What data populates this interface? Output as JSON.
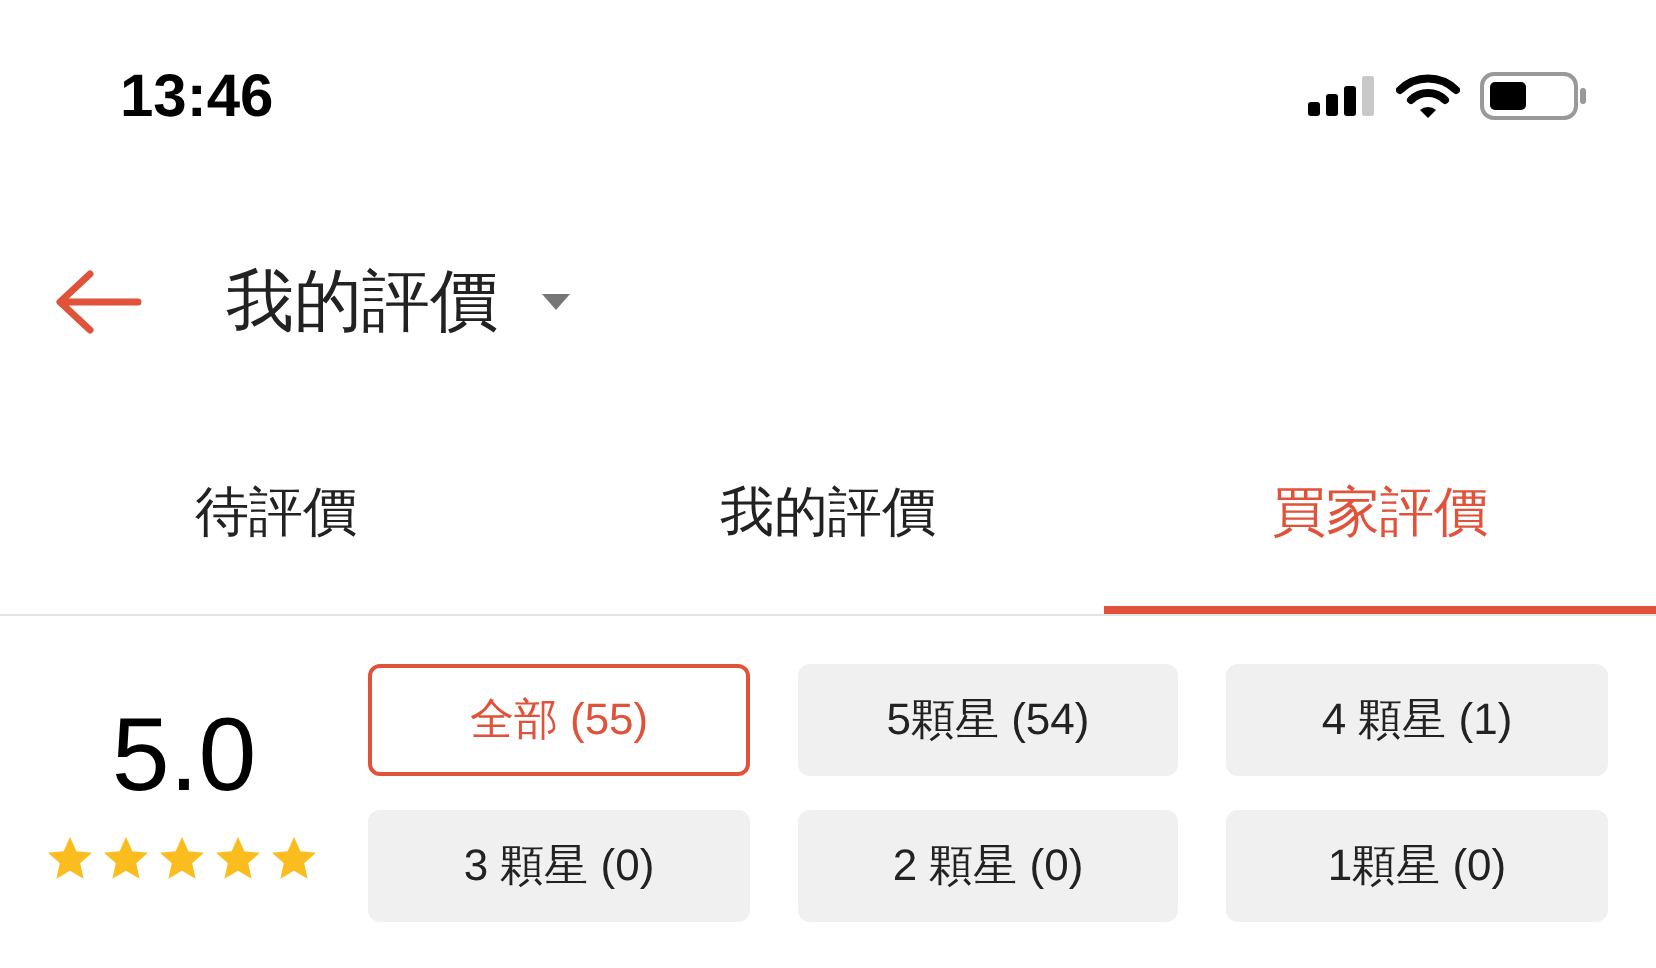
{
  "status_bar": {
    "time": "13:46"
  },
  "header": {
    "title": "我的評價"
  },
  "tabs": [
    {
      "label": "待評價",
      "selected": false
    },
    {
      "label": "我的評價",
      "selected": false
    },
    {
      "label": "買家評價",
      "selected": true
    }
  ],
  "rating": {
    "score": "5.0",
    "stars": 5
  },
  "filters": [
    {
      "label": "全部 (55)",
      "selected": true
    },
    {
      "label": "5顆星 (54)",
      "selected": false
    },
    {
      "label": "4 顆星 (1)",
      "selected": false
    },
    {
      "label": "3 顆星 (0)",
      "selected": false
    },
    {
      "label": "2 顆星 (0)",
      "selected": false
    },
    {
      "label": "1顆星 (0)",
      "selected": false
    }
  ]
}
